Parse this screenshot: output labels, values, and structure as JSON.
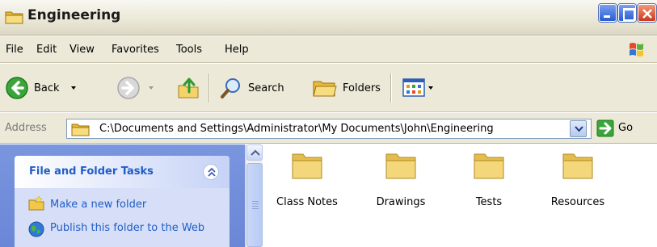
{
  "window": {
    "title": "Engineering",
    "controls": [
      "minimize-icon",
      "maximize-icon",
      "close-icon"
    ]
  },
  "menu": {
    "items": [
      "File",
      "Edit",
      "View",
      "Favorites",
      "Tools",
      "Help"
    ]
  },
  "toolbar": {
    "back_label": "Back",
    "search_label": "Search",
    "folders_label": "Folders"
  },
  "address": {
    "label": "Address",
    "path": "C:\\Documents and Settings\\Administrator\\My Documents\\John\\Engineering",
    "go_label": "Go"
  },
  "tasks": {
    "header": "File and Folder Tasks",
    "links": [
      "Make a new folder",
      "Publish this folder to the Web"
    ]
  },
  "files": [
    {
      "name": "Class Notes",
      "icon": "folder-icon"
    },
    {
      "name": "Drawings",
      "icon": "folder-icon"
    },
    {
      "name": "Tests",
      "icon": "folder-icon"
    },
    {
      "name": "Resources",
      "icon": "folder-icon"
    }
  ],
  "colors": {
    "task_link": "#215dc6",
    "taskpane_bg": "#6a86d6",
    "chrome_bg": "#ece9d8",
    "folder": "#f3d77a"
  }
}
